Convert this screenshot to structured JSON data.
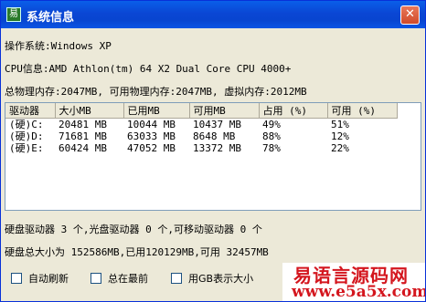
{
  "window": {
    "title": "系统信息",
    "close_glyph": "✕"
  },
  "os_line": "操作系统:Windows XP",
  "cpu_line": "CPU信息:AMD Athlon(tm) 64 X2 Dual Core CPU 4000+",
  "memory_line": "总物理内存:2047MB, 可用物理内存:2047MB, 虚拟内存:2012MB",
  "drive_table": {
    "headers": [
      "驱动器",
      "大小MB",
      "已用MB",
      "可用MB",
      "占用 (%)",
      "可用 (%)"
    ],
    "rows": [
      [
        "(硬)C:",
        "20481 MB",
        "10044 MB",
        "10437 MB",
        "49%",
        "51%"
      ],
      [
        "(硬)D:",
        "71681 MB",
        "63033 MB",
        "8648 MB",
        "88%",
        "12%"
      ],
      [
        "(硬)E:",
        "60424 MB",
        "47052 MB",
        "13372 MB",
        "78%",
        "22%"
      ]
    ]
  },
  "drive_count_line": "硬盘驱动器 3 个,光盘驱动器 0 个,可移动驱动器 0 个",
  "disk_total_line": "硬盘总大小为 152586MB,已用120129MB,可用 32457MB",
  "options": {
    "auto_refresh": "自动刷新",
    "always_on_top": "总在最前",
    "show_in_gb": "用GB表示大小"
  },
  "watermark": {
    "line1": "易语言源码网",
    "line2": "www.e5a5x.com"
  },
  "colors": {
    "titlebar": "#0a46d4",
    "window_bg": "#ece9d8",
    "watermark": "#d4161e"
  },
  "icons": {
    "app": "app-icon",
    "close": "close-icon"
  }
}
